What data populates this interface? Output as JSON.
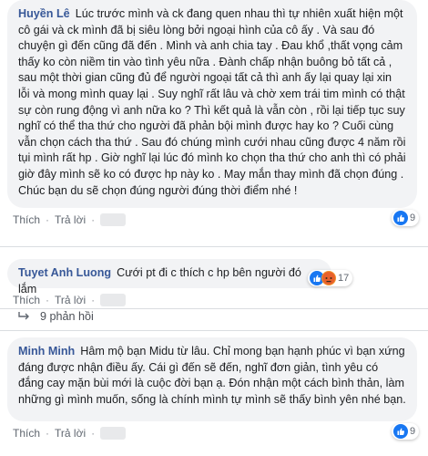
{
  "comments": [
    {
      "name": "Huyền Lê",
      "text": "Lúc trước mình và ck đang quen nhau thì tự nhiên xuất hiện một cô gái và ck mình đã bị siêu lòng bởi ngoại hình của cô ấy . Và sau đó chuyện gì đến cũng đã đến . Mình và anh chia tay . Đau khổ ,thất vọng cảm thấy ko còn niềm tin vào tình yêu nữa . Đành chấp nhận buông bỏ tất cả , sau một thời gian cũng đủ để người ngoại tất cả thì anh ấy lại quay lại xin lỗi và mong mình quay lại . Suy nghĩ rất lâu và chờ xem trái tim mình có thật sự còn rung động vì anh nữa ko ? Thì kết quả là vẫn còn , rồi lại tiếp tục suy nghĩ có thể tha thứ cho người đã phản bội mình được hay ko ? Cuối cùng vẫn chọn cách tha thứ . Sau đó chúng mình cưới nhau cũng được 4 năm rồi tụi mình rất hp . Giờ nghĩ lại lúc đó mình ko chọn tha thứ cho anh thì có phải giờ đây mình sẽ ko có được hp này ko . May mắn thay mình đã chọn đúng . Chúc bạn du sẽ chọn đúng người đúng thời điểm nhé !",
      "like_label": "Thích",
      "reply_label": "Trả lời",
      "reaction_count": "9"
    },
    {
      "name": "Tuyet Anh Luong",
      "text": "Cưới pt đi c thích c hp bên người đó lắm",
      "like_label": "Thích",
      "reply_label": "Trả lời",
      "reaction_count": "17"
    },
    {
      "name": "Minh Minh",
      "text": "Hâm mộ bạn Midu từ lâu. Chỉ mong bạn hạnh phúc vì bạn xứng đáng được nhận điều ấy. Cái gì đến sẽ đến, nghĩ đơn giản, tình yêu có đắng cay mặn bùi mới là cuộc đời bạn ạ. Đón nhận một cách bình thản, làm những gì mình muốn, sống là chính mình tự mình sẽ thấy bình yên nhé bạn.",
      "like_label": "Thích",
      "reply_label": "Trả lời",
      "reaction_count": "9"
    }
  ],
  "replies_link": "9 phản hồi",
  "colors": {
    "name": "#385898",
    "bubble": "#f2f3f5",
    "like": "#1877f2",
    "angry": "#f0932b"
  }
}
